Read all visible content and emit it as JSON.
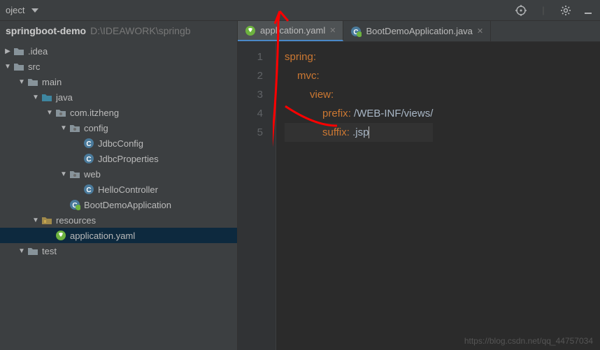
{
  "toolbar": {
    "project_label": "oject"
  },
  "breadcrumb": {
    "project": "springboot-demo",
    "path": "D:\\IDEAWORK\\springb"
  },
  "tree": {
    "idea": ".idea",
    "src": "src",
    "main": "main",
    "java": "java",
    "pkg": "com.itzheng",
    "config": "config",
    "jdbcConfig": "JdbcConfig",
    "jdbcProps": "JdbcProperties",
    "web": "web",
    "hello": "HelloController",
    "boot": "BootDemoApplication",
    "resources": "resources",
    "appyaml": "application.yaml",
    "test": "test"
  },
  "tabs": [
    {
      "label": "application.yaml",
      "active": true
    },
    {
      "label": "BootDemoApplication.java",
      "active": false
    }
  ],
  "code": {
    "lines": [
      "1",
      "2",
      "3",
      "4",
      "5"
    ],
    "l1_key": "spring",
    "colon": ":",
    "l2_key": "mvc",
    "l3_key": "view",
    "l4_key": "prefix",
    "l4_val": " /WEB-INF/views/",
    "l5_key": "suffix",
    "l5_val": " .jsp"
  },
  "watermark": "https://blog.csdn.net/qq_44757034"
}
